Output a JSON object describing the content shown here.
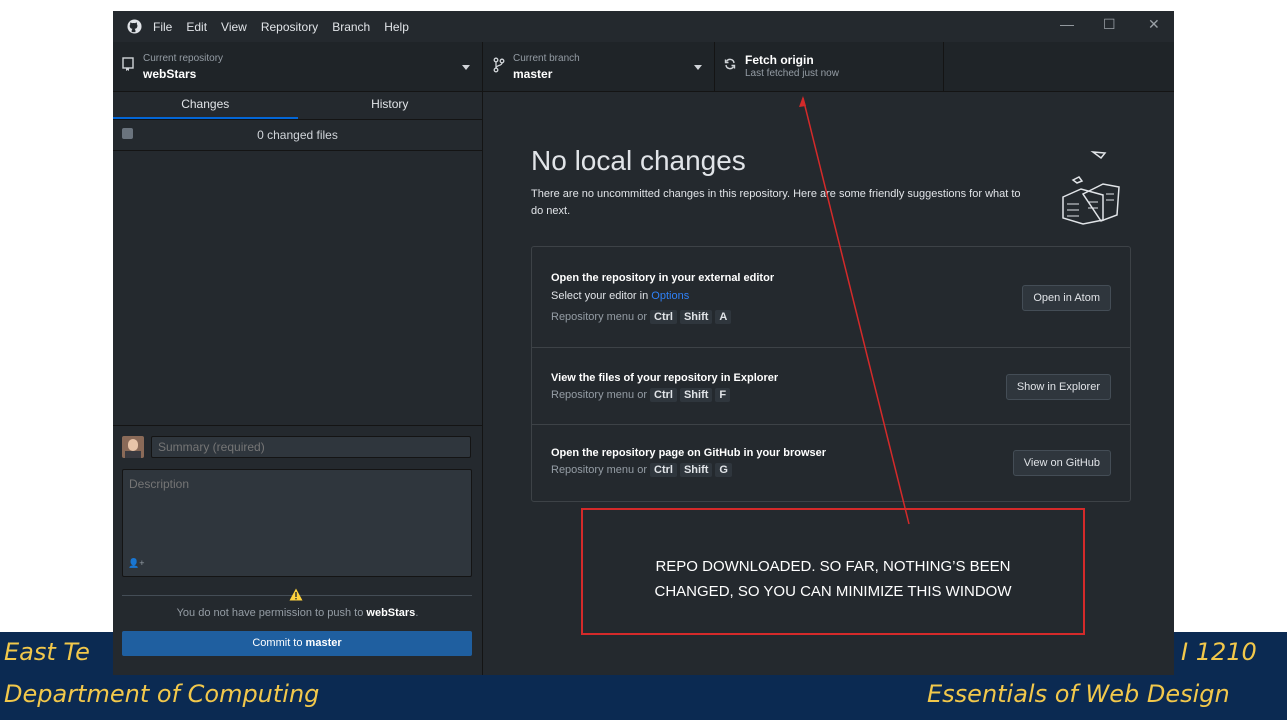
{
  "colors": {
    "app_bg": "#24292e",
    "footer_bg": "#0b2a52",
    "footer_text": "#f2c84b",
    "accent_blue": "#0366d6",
    "annotation_red": "#d42a2a"
  },
  "slide_footer": {
    "left_line1": "East Te",
    "right_line1": "I 1210",
    "left_line2": "Department of Computing",
    "right_line2": "Essentials of Web Design"
  },
  "menu": [
    "File",
    "Edit",
    "View",
    "Repository",
    "Branch",
    "Help"
  ],
  "window_controls": {
    "minimize": "—",
    "maximize": "☐",
    "close": "✕"
  },
  "toolbar": {
    "repo_label": "Current repository",
    "repo_value": "webStars",
    "branch_label": "Current branch",
    "branch_value": "master",
    "fetch_label": "Fetch origin",
    "fetch_status": "Last fetched just now"
  },
  "sidebar": {
    "tabs": [
      "Changes",
      "History"
    ],
    "changed_files": "0 changed files",
    "summary_placeholder": "Summary (required)",
    "description_placeholder": "Description",
    "permission_prefix": "You do not have permission to push to ",
    "permission_repo": "webStars",
    "permission_suffix": ".",
    "commit_prefix": "Commit to ",
    "commit_branch": "master"
  },
  "main": {
    "heading": "No local changes",
    "subtext": "There are no uncommitted changes in this repository. Here are some friendly suggestions for what to do next.",
    "suggestions": [
      {
        "title": "Open the repository in your external editor",
        "line2_prefix": "Select your editor in ",
        "line2_link": "Options",
        "hint": "Repository menu or",
        "keys": [
          "Ctrl",
          "Shift",
          "A"
        ],
        "button": "Open in Atom"
      },
      {
        "title": "View the files of your repository in Explorer",
        "hint": "Repository menu or",
        "keys": [
          "Ctrl",
          "Shift",
          "F"
        ],
        "button": "Show in Explorer"
      },
      {
        "title": "Open the repository page on GitHub in your browser",
        "hint": "Repository menu or",
        "keys": [
          "Ctrl",
          "Shift",
          "G"
        ],
        "button": "View on GitHub"
      }
    ]
  },
  "annotation": {
    "line1": "REPO DOWNLOADED. SO FAR, NOTHING’S BEEN",
    "line2": "CHANGED, SO YOU CAN MINIMIZE THIS WINDOW"
  }
}
